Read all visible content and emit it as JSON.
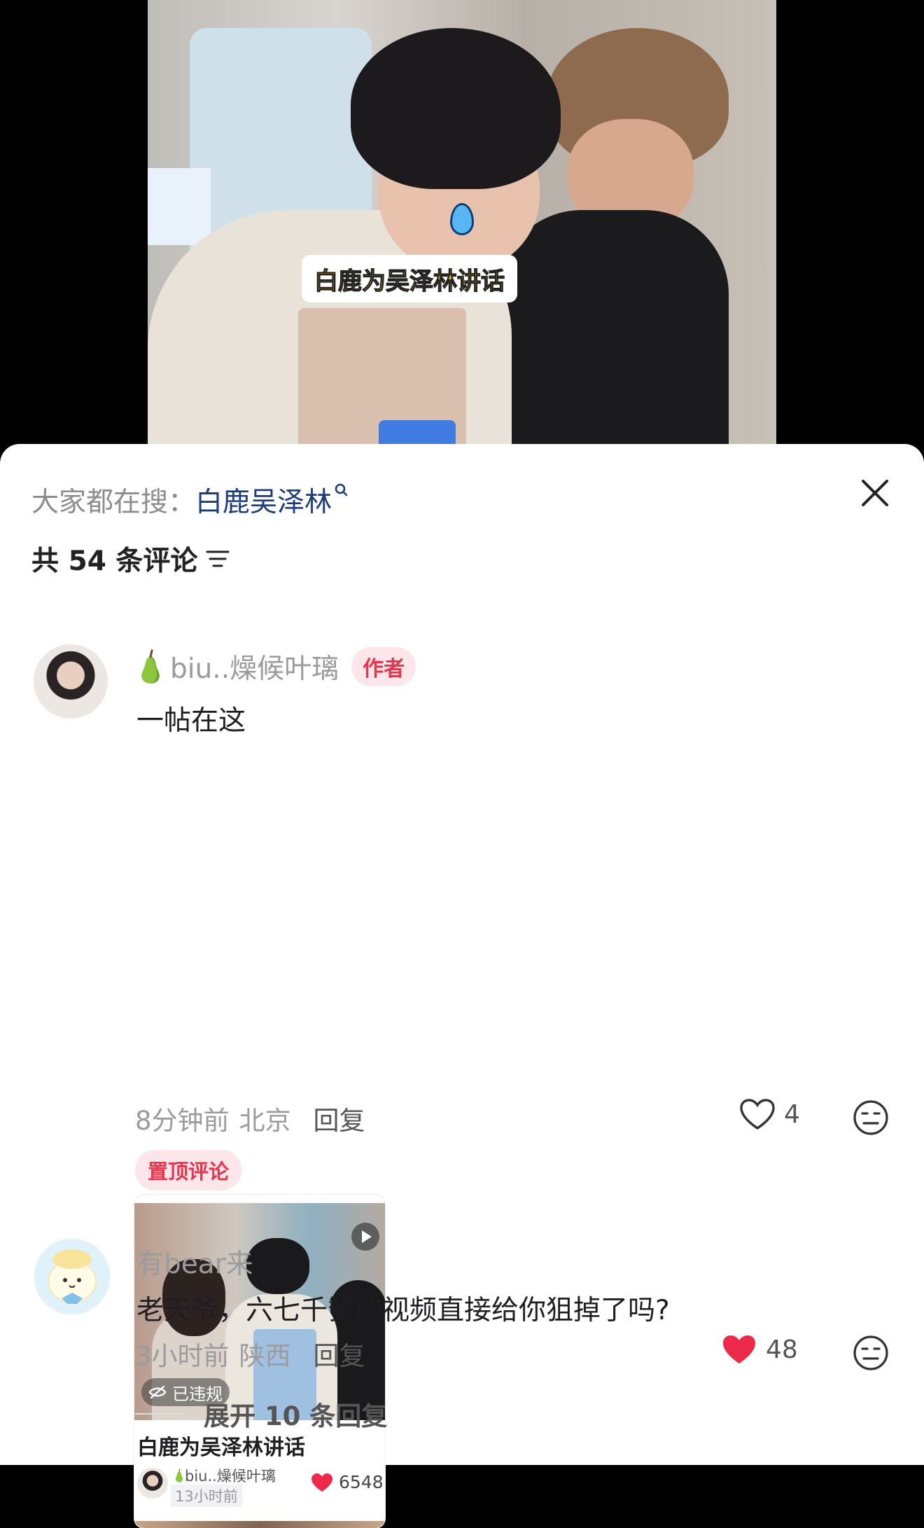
{
  "video": {
    "caption": "白鹿为吴泽林讲话"
  },
  "search": {
    "prefix": "大家都在搜：",
    "term": "白鹿吴泽林"
  },
  "comments_header": {
    "count_text": "共 54 条评论"
  },
  "comments": [
    {
      "username": "biu..燥候叶璃",
      "author_badge": "作者",
      "text": "一帖在这",
      "card": {
        "violation_label": "已违规",
        "title": "白鹿为吴泽林讲话",
        "user": "biu..燥候叶璃",
        "time": "13小时前",
        "likes": "6548"
      },
      "time": "8分钟前",
      "location": "北京",
      "reply_label": "回复",
      "likes": "4",
      "liked": false,
      "pinned_label": "置顶评论"
    },
    {
      "username": "有bear来",
      "text": "老天爷，六七千赞的视频直接给你狙掉了吗?",
      "time": "3小时前",
      "location": "陕西",
      "reply_label": "回复",
      "likes": "48",
      "liked": true,
      "expand_label": "展开 10 条回复"
    }
  ],
  "colors": {
    "accent_red": "#e8354e",
    "search_term": "#1b3b7a",
    "caption_yellow": "#f2c51c"
  }
}
